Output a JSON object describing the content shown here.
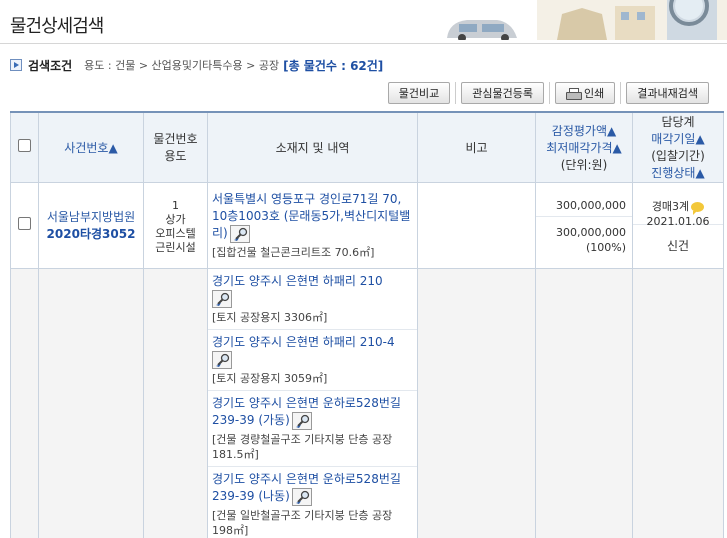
{
  "page": {
    "title": "물건상세검색"
  },
  "criteria": {
    "label": "검색조건",
    "path": "용도 : 건물 > 산업용및기타특수용 > 공장",
    "total": "[총 물건수 : 62건]"
  },
  "toolbar": {
    "compare": "물건비교",
    "interest": "관심물건등록",
    "print": "인쇄",
    "refine": "결과내재검색"
  },
  "table": {
    "headers": {
      "case": "사건번호▲",
      "item_line1": "물건번호",
      "item_line2": "용도",
      "location": "소재지 및 내역",
      "note": "비고",
      "price_line1": "감정평가액▲",
      "price_line2": "최저매각가격▲",
      "price_line3": "(단위:원)",
      "status_line1": "담당계",
      "status_line2": "매각기일▲",
      "status_line3": "(입찰기간)",
      "status_line4": "진행상태▲"
    },
    "rows": [
      {
        "court": "서울남부지방법원",
        "case_no": "2020타경3052",
        "item_no": "1",
        "use_line1": "상가",
        "use_line2": "오피스텔",
        "use_line3": "근린시설",
        "address": "서울특별시 영등포구 경인로71길 70, 10층1003호 (문래동5가,벽산디지털밸리)",
        "detail": "[집합건물 철근콘크리트조 70.6㎡]",
        "appraisal": "300,000,000",
        "min_price": "300,000,000",
        "min_pct": "(100%)",
        "dept": "경매3계",
        "date": "2021.01.06",
        "status": "신건"
      }
    ],
    "multi_row": {
      "addresses": [
        {
          "address": "경기도 양주시 은현면 하패리 210",
          "detail": "[토지 공장용지 3306㎡]"
        },
        {
          "address": "경기도 양주시 은현면 하패리 210-4",
          "detail": "[토지 공장용지 3059㎡]"
        },
        {
          "address": "경기도 양주시 은현면 운하로528번길 239-39 (가동)",
          "detail": "[건물 경량철골구조 기타지붕 단층 공장 181.5㎡]"
        },
        {
          "address": "경기도 양주시 은현면 운하로528번길 239-39 (나동)",
          "detail": "[건물 일반철골구조 기타지붕 단층 공장 198㎡]"
        }
      ]
    }
  },
  "colors": {
    "link": "#1e4fa3",
    "header_bg": "#eef3f8",
    "border": "#c9d3df"
  }
}
